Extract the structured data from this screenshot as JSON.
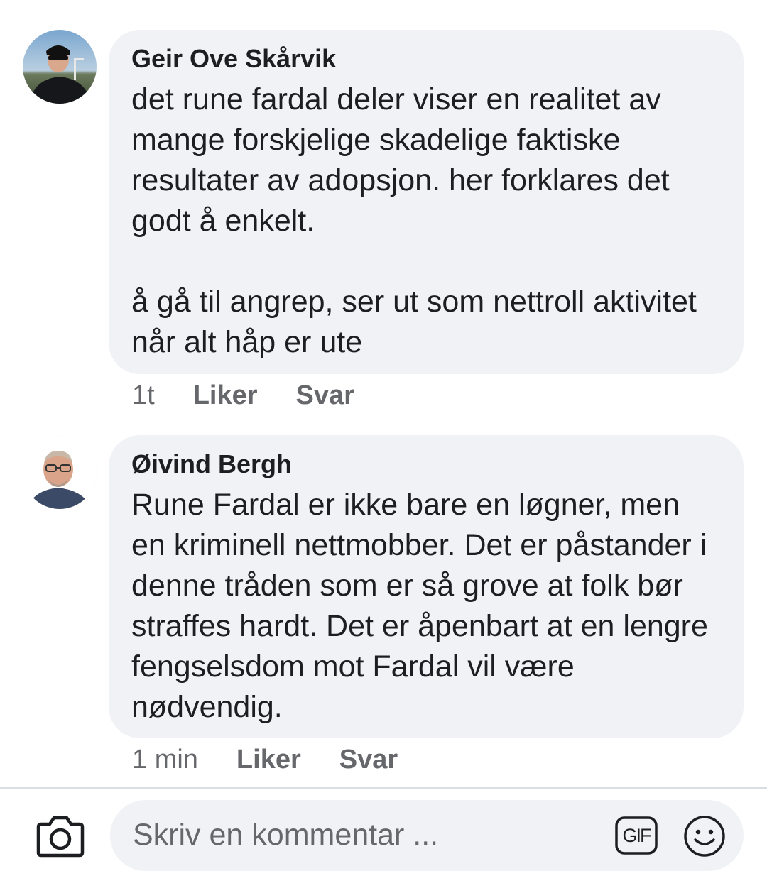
{
  "comments": [
    {
      "author": "Geir Ove Skårvik",
      "text": "det rune fardal deler viser en realitet av mange forskjelige skadelige faktiske resultater av adopsjon. her forklares det godt å enkelt.\n\nå gå til angrep, ser ut som nettroll aktivitet når alt håp er ute",
      "time": "1t",
      "like_label": "Liker",
      "reply_label": "Svar"
    },
    {
      "author": "Øivind Bergh",
      "text": "Rune Fardal er ikke bare en løgner, men en kriminell nettmobber. Det er påstander i denne tråden som er så grove at folk bør straffes hardt. Det er åpenbart at en lengre fengselsdom mot Fardal vil være nødvendig.",
      "time": "1 min",
      "like_label": "Liker",
      "reply_label": "Svar"
    }
  ],
  "composer": {
    "placeholder": "Skriv en kommentar ...",
    "gif_label": "GIF",
    "camera_icon": "camera-icon",
    "smiley_icon": "smiley-icon"
  },
  "colors": {
    "bubble": "#f0f2f5",
    "meta_text": "#65676b",
    "body_text": "#1c1e21"
  }
}
